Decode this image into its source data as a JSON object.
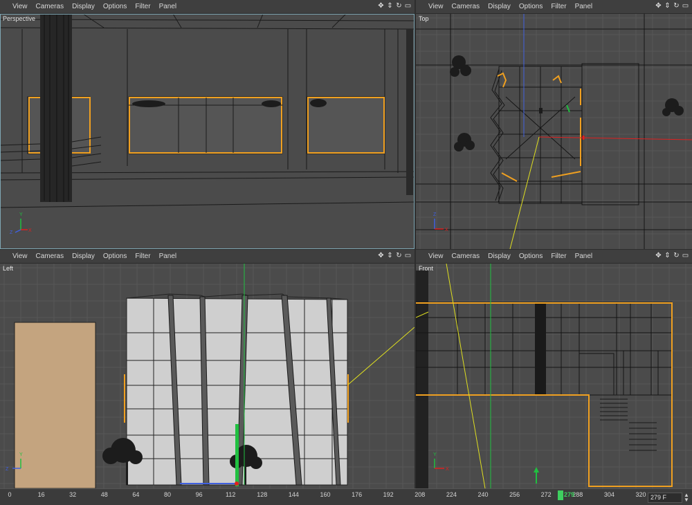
{
  "menu_items": [
    "View",
    "Cameras",
    "Display",
    "Options",
    "Filter",
    "Panel"
  ],
  "nav_icons": [
    "move-view-icon",
    "zoom-view-icon",
    "rotate-view-icon",
    "toggle-layout-icon"
  ],
  "viewports": {
    "perspective": {
      "label": "Perspective"
    },
    "top": {
      "label": "Top"
    },
    "left": {
      "label": "Left"
    },
    "front": {
      "label": "Front"
    }
  },
  "axis_labels": {
    "x": "X",
    "y": "Y",
    "z": "Z"
  },
  "timeline": {
    "ticks": [
      "0",
      "16",
      "32",
      "48",
      "64",
      "80",
      "96",
      "112",
      "128",
      "144",
      "160",
      "176",
      "192",
      "208",
      "224",
      "240",
      "256",
      "272",
      "288",
      "304",
      "320"
    ],
    "current_frame_marker": "279",
    "frame_field": "279 F"
  },
  "colors": {
    "selection": "#f0a020",
    "wire": "#141414",
    "grid": "#555555",
    "axis_x": "#e02020",
    "axis_y": "#20c040",
    "axis_z": "#4060e0"
  }
}
